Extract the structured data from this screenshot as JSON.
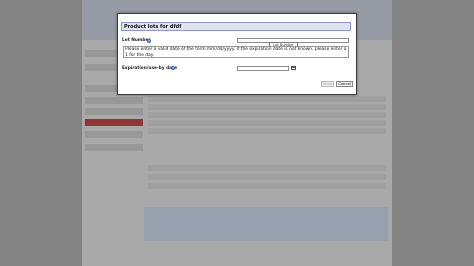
{
  "dialog": {
    "title": "Product lots for dfdf",
    "lot_label": "Lot Number",
    "lot_value": "",
    "tooltip": "Lot Number",
    "validation": "Please enter a valid date of the form mm/dd/yyyy. If the expiration date is not known, please enter a 1 for the day.",
    "expiration_label": "Expiration/use-by date",
    "expiration_value": "",
    "save_label": "Save",
    "cancel_label": "Cancel"
  },
  "icons": {
    "help": "help-icon",
    "calendar": "calendar-icon"
  },
  "colors": {
    "title_bar": "#dfe3f2",
    "title_border": "#8c96c7",
    "help_icon": "#3d6ab8"
  }
}
